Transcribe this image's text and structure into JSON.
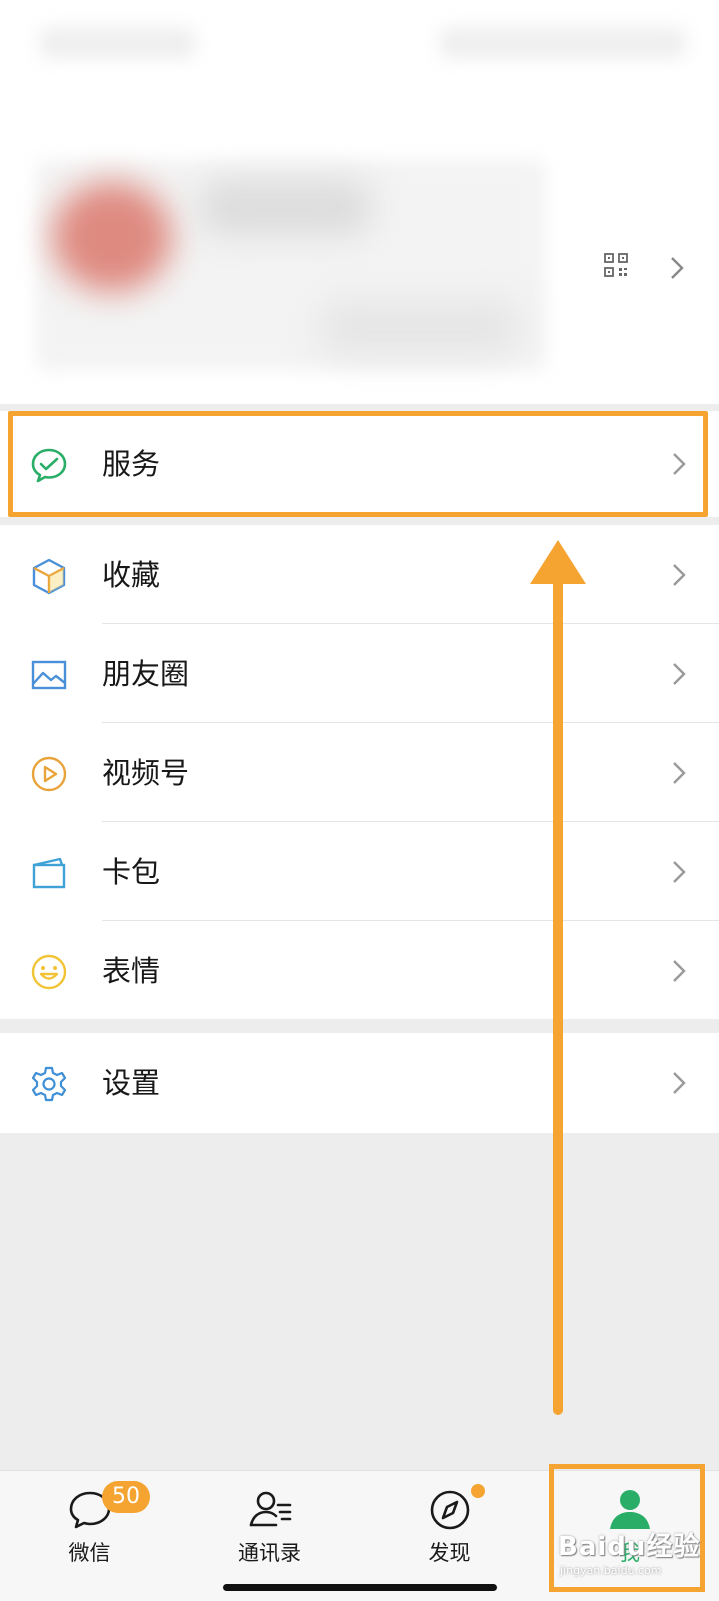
{
  "menu": {
    "services": {
      "label": "服务",
      "icon": "services-icon"
    },
    "group2": [
      {
        "label": "收藏",
        "icon": "favorites-icon"
      },
      {
        "label": "朋友圈",
        "icon": "moments-icon"
      },
      {
        "label": "视频号",
        "icon": "channels-icon"
      },
      {
        "label": "卡包",
        "icon": "cards-icon"
      },
      {
        "label": "表情",
        "icon": "stickers-icon"
      }
    ],
    "settings": {
      "label": "设置",
      "icon": "gear-icon"
    }
  },
  "tabbar": {
    "tabs": [
      {
        "label": "微信",
        "icon": "chats-icon",
        "badge": "50"
      },
      {
        "label": "通讯录",
        "icon": "contacts-icon"
      },
      {
        "label": "发现",
        "icon": "discover-icon"
      },
      {
        "label": "我",
        "icon": "me-icon",
        "active": true
      }
    ]
  },
  "watermark": {
    "text": "Baidu经验",
    "sub": "jingyan.baidu.com"
  },
  "colors": {
    "highlight": "#f5a431",
    "active_tab": "#2aae67"
  }
}
